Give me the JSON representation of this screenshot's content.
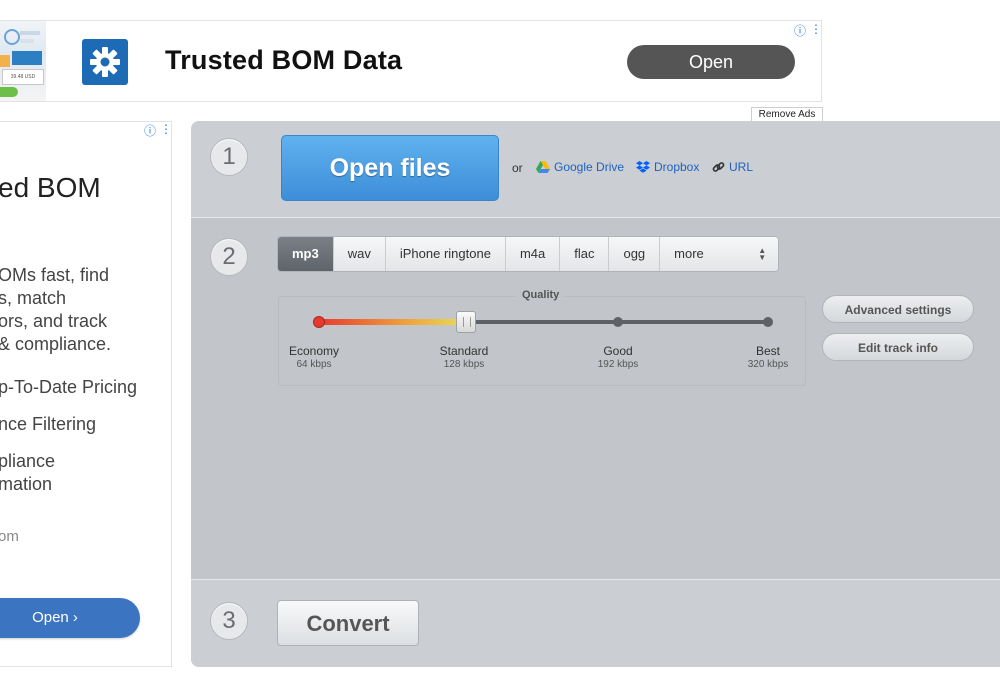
{
  "top_ad": {
    "thumb_price": "39.48",
    "thumb_currency": "USD",
    "title": "Trusted BOM Data",
    "open_label": "Open",
    "info_icon": "info-icon",
    "menu_icon": "more-vert-icon"
  },
  "remove_ads_label": "Remove Ads",
  "side_ad": {
    "title": "ed BOM",
    "desc_lines": [
      "OMs fast, find",
      "s, match",
      "ors, and track",
      "& compliance."
    ],
    "features": [
      "p-To-Date Pricing",
      "nce Filtering",
      "pliance",
      "mation"
    ],
    "domain": "om",
    "open_label": "Open ›"
  },
  "steps": {
    "step1_number": "1",
    "step2_number": "2",
    "step3_number": "3"
  },
  "step1": {
    "open_files_label": "Open files",
    "or_label": "or",
    "sources": [
      {
        "label": "Google Drive",
        "icon": "google-drive-icon"
      },
      {
        "label": "Dropbox",
        "icon": "dropbox-icon"
      },
      {
        "label": "URL",
        "icon": "link-icon"
      }
    ]
  },
  "step2": {
    "formats": [
      "mp3",
      "wav",
      "iPhone ringtone",
      "m4a",
      "flac",
      "ogg",
      "more"
    ],
    "selected_format": "mp3",
    "quality_title": "Quality",
    "quality_levels": [
      {
        "name": "Economy",
        "rate": "64 kbps"
      },
      {
        "name": "Standard",
        "rate": "128 kbps"
      },
      {
        "name": "Good",
        "rate": "192 kbps"
      },
      {
        "name": "Best",
        "rate": "320 kbps"
      }
    ],
    "selected_quality": "Standard",
    "advanced_settings_label": "Advanced settings",
    "edit_track_info_label": "Edit track info"
  },
  "step3": {
    "convert_label": "Convert"
  },
  "colors": {
    "primary_button": "#4a9de2",
    "panel_bg": "#c2c5c9",
    "link": "#1e62c0",
    "ad_open": "#3b74c0"
  }
}
